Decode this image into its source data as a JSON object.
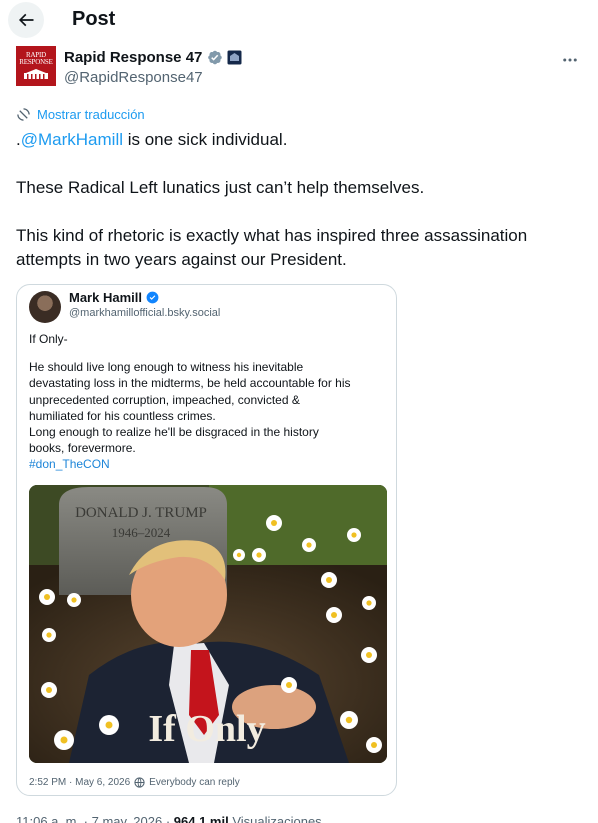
{
  "header": {
    "title": "Post",
    "back_icon": "arrow-left-icon"
  },
  "author": {
    "name": "Rapid Response 47",
    "handle": "@RapidResponse47",
    "avatar_text": [
      "RAPID",
      "RESPONSE"
    ],
    "badges": [
      "verified-gray-icon",
      "government-affiliation-icon"
    ]
  },
  "more_icon": "more-horizontal-icon",
  "translate": {
    "label": "Mostrar traducción",
    "icon": "translate-icon"
  },
  "tweet": {
    "line1_prefix": ".",
    "mention": "@MarkHamill",
    "line1_suffix": " is one sick individual.",
    "paragraph2": "These Radical Left lunatics just can’t help themselves.",
    "paragraph3_line1": "This kind of rhetoric is exactly what has inspired three assassination",
    "paragraph3_line2": "attempts in two years against our President."
  },
  "embed": {
    "name": "Mark Hamill",
    "handle": "@markhamillofficial.bsky.social",
    "body_line1": "If Only-",
    "body_lines": [
      "He should live long enough to witness his inevitable",
      "devastating loss in the midterms, be held accountable for his",
      "unprecedented corruption, impeached, convicted &",
      "humiliated for his countless crimes.",
      "Long enough to realize he'll be disgraced in the history",
      "books, forevermore."
    ],
    "hashtag": "#don_TheCON",
    "image": {
      "headstone_name": "DONALD J. TRUMP",
      "headstone_years": "1946–2024",
      "caption": "If Only"
    },
    "footer_time": "2:52 PM · May 6, 2026",
    "footer_reply": "Everybody can reply"
  },
  "meta": {
    "time": "11:06 a. m. · 7 may. 2026 · ",
    "views_count": "964,1 mil",
    "views_label": " Visualizaciones"
  },
  "colors": {
    "accent": "#1d9bf0",
    "text": "#0f1419",
    "muted": "#536471",
    "border": "#cfd9de",
    "avatar_bg": "#b3151c"
  }
}
